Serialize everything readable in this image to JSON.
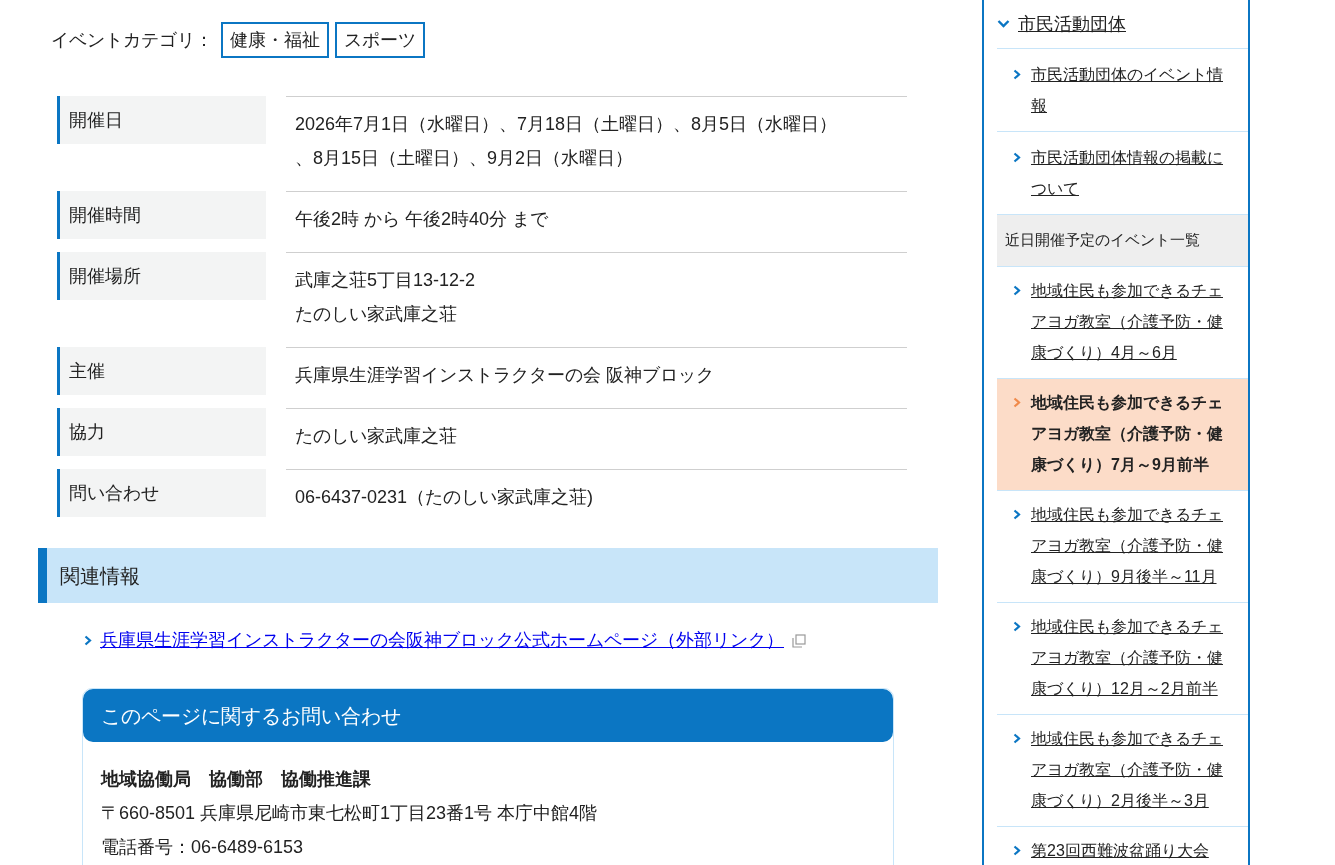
{
  "category": {
    "label": "イベントカテゴリ：",
    "tags": [
      "健康・福祉",
      "スポーツ"
    ]
  },
  "details": [
    {
      "label": "開催日",
      "lines": [
        "2026年7月1日（水曜日）、7月18日（土曜日）、8月5日（水曜日）",
        "、8月15日（土曜日）、9月2日（水曜日）"
      ]
    },
    {
      "label": "開催時間",
      "lines": [
        "午後2時 から 午後2時40分 まで"
      ]
    },
    {
      "label": "開催場所",
      "lines": [
        "武庫之荘5丁目13-12-2",
        "たのしい家武庫之荘"
      ]
    },
    {
      "label": "主催",
      "lines": [
        "兵庫県生涯学習インストラクターの会 阪神ブロック"
      ]
    },
    {
      "label": "協力",
      "lines": [
        "たのしい家武庫之荘"
      ]
    },
    {
      "label": "問い合わせ",
      "lines": [
        "06-6437-0231（たのしい家武庫之荘)"
      ]
    }
  ],
  "related": {
    "heading": "関連情報",
    "links": [
      "兵庫県生涯学習インストラクターの会阪神ブロック公式ホームページ（外部リンク）"
    ]
  },
  "contact": {
    "heading": "このページに関するお問い合わせ",
    "department": "地域協働局　協働部　協働推進課",
    "address": "〒660-8501 兵庫県尼崎市東七松町1丁目23番1号 本庁中館4階",
    "phone": "電話番号：06-6489-6153"
  },
  "sidebar": {
    "heading": "市民活動団体",
    "expanded": true,
    "links": [
      "市民活動団体のイベント情報",
      "市民活動団体情報の掲載について"
    ],
    "section": "近日開催予定のイベント一覧",
    "events": [
      {
        "label": "地域住民も参加できるチェアヨガ教室（介護予防・健康づくり）4月～6月",
        "selected": false
      },
      {
        "label": "地域住民も参加できるチェアヨガ教室（介護予防・健康づくり）7月～9月前半",
        "selected": true
      },
      {
        "label": "地域住民も参加できるチェアヨガ教室（介護予防・健康づくり）9月後半～11月",
        "selected": false
      },
      {
        "label": "地域住民も参加できるチェアヨガ教室（介護予防・健康づくり）12月～2月前半",
        "selected": false
      },
      {
        "label": "地域住民も参加できるチェアヨガ教室（介護予防・健康づくり）2月後半～3月",
        "selected": false
      },
      {
        "label": "第23回西難波盆踊り大会",
        "selected": false
      }
    ]
  }
}
